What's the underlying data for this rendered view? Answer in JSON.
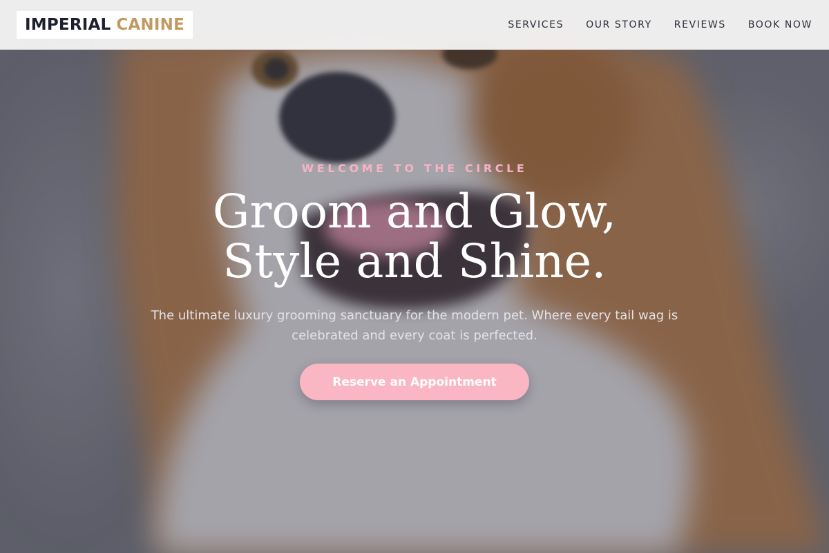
{
  "brand": {
    "name_part1": "IMPERIAL",
    "name_part2": "CANINE"
  },
  "nav": {
    "items": [
      {
        "label": "SERVICES"
      },
      {
        "label": "OUR STORY"
      },
      {
        "label": "REVIEWS"
      },
      {
        "label": "BOOK NOW"
      }
    ]
  },
  "hero": {
    "eyebrow": "WELCOME TO THE CIRCLE",
    "headline_line1": "Groom and Glow,",
    "headline_line2": "Style and Shine.",
    "subtext": "The ultimate luxury grooming sanctuary for the modern pet. Where every tail wag is celebrated and every coat is perfected.",
    "cta_label": "Reserve an Appointment",
    "background_image": "corgi-photo"
  },
  "colors": {
    "brand_navy": "#1c1f2e",
    "brand_gold": "#c19a62",
    "accent_pink": "#fbb6c4",
    "eyebrow_pink": "#f5b3c4"
  }
}
